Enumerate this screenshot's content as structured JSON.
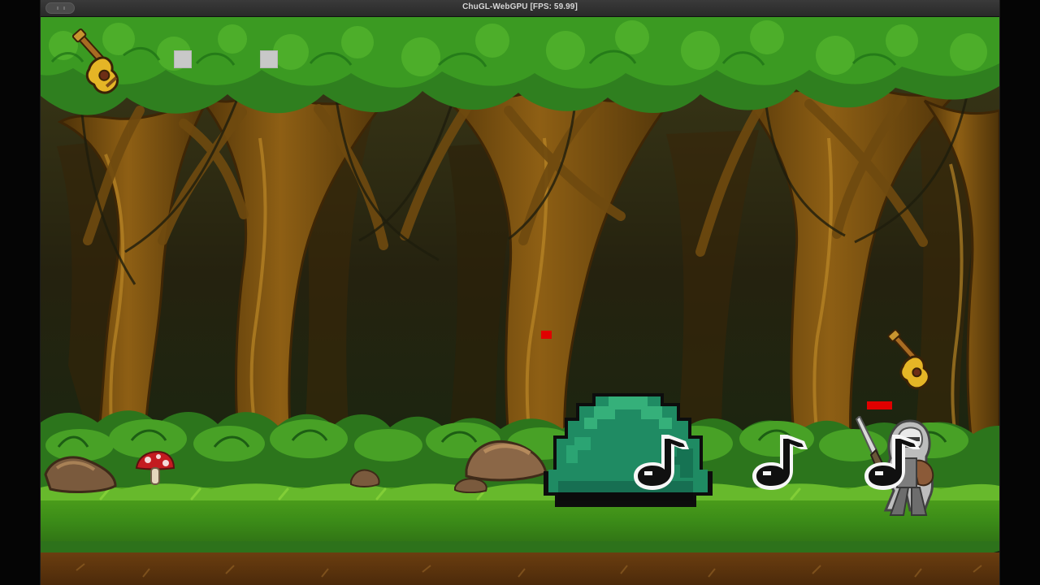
{
  "window": {
    "title": "ChuGL-WebGPU [FPS: 59.99]"
  },
  "hud": {
    "weapon_icon": "guitar-icon",
    "lives_icons": [
      "square-icon",
      "square-icon"
    ]
  },
  "scene": {
    "background": "forest",
    "enemy": "green-slime",
    "player": "armored-knight",
    "projectiles": [
      "music-note-icon",
      "music-note-icon",
      "music-note-icon"
    ],
    "pickup": "guitar-icon",
    "props": [
      "red-mushroom-icon",
      "rock-icon",
      "rock-icon",
      "rock-icon",
      "rock-icon"
    ]
  },
  "colors": {
    "foliage": "#2f7f1f",
    "bark": "#7a4f12",
    "slime": "#1f8b63",
    "red_marker": "#e00000",
    "lives": "#c8c8c8"
  }
}
